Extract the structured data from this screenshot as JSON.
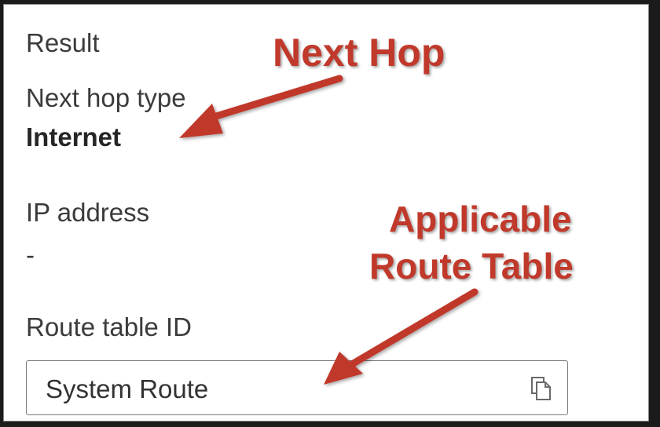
{
  "result_panel": {
    "title": "Result",
    "next_hop_type": {
      "label": "Next hop type",
      "value": "Internet"
    },
    "ip_address": {
      "label": "IP address",
      "value": "-"
    },
    "route_table_id": {
      "label": "Route table ID",
      "value": "System Route",
      "copy_icon": "copy-icon"
    }
  },
  "annotations": {
    "next_hop": "Next Hop",
    "route_table_line1": "Applicable",
    "route_table_line2": "Route Table",
    "color": "#c0392b"
  }
}
